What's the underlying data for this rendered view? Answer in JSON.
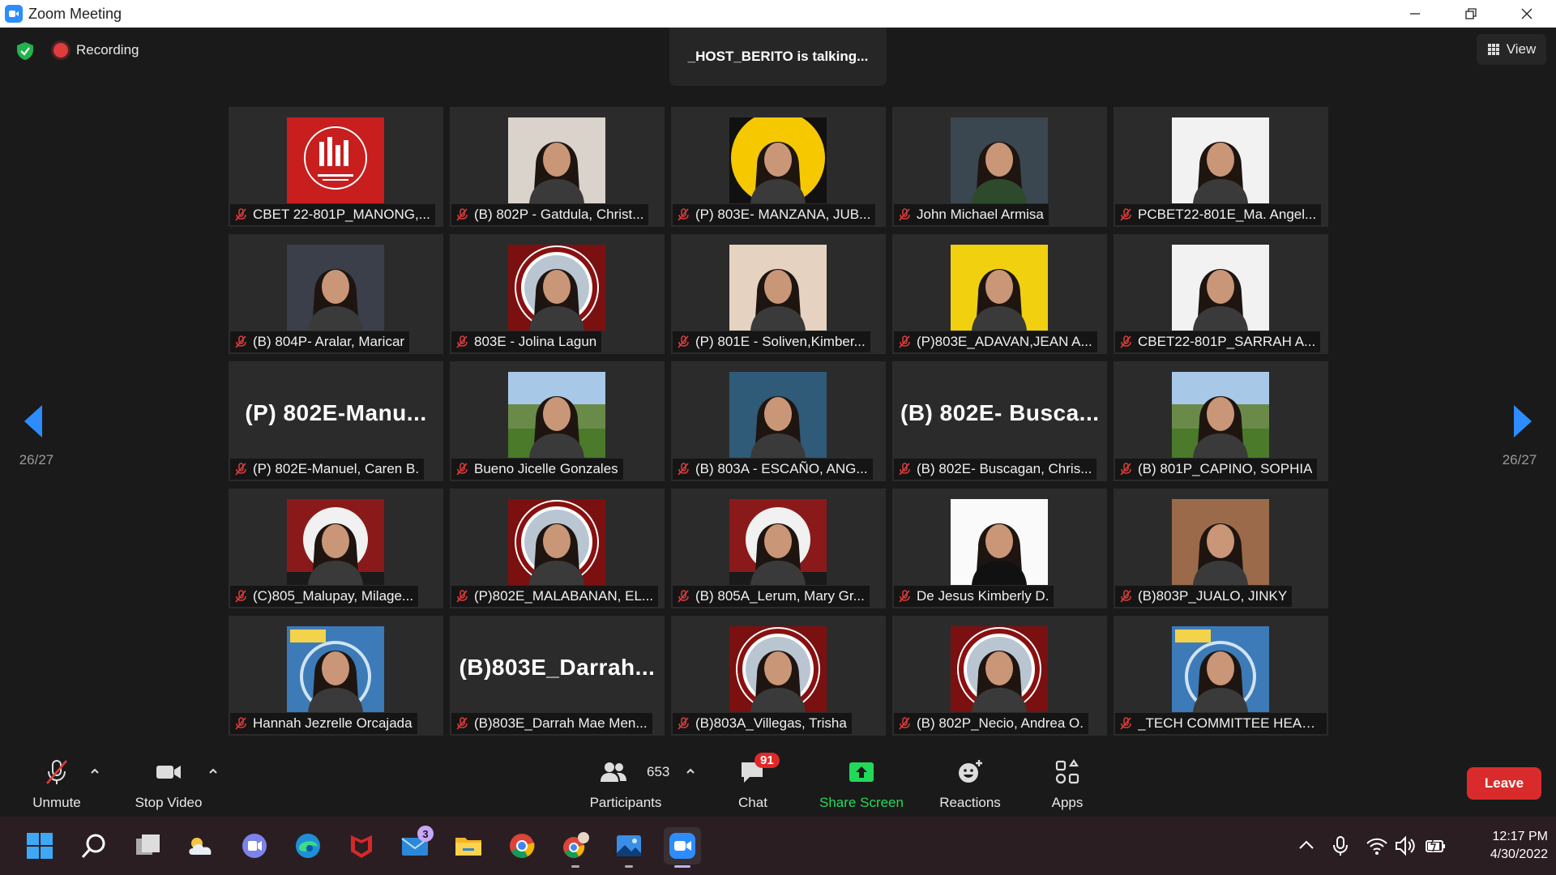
{
  "window": {
    "title": "Zoom Meeting"
  },
  "meeting": {
    "recording_label": "Recording",
    "talking_label": "_HOST_BERITO is talking...",
    "view_label": "View",
    "page_indicator_left": "26/27",
    "page_indicator_right": "26/27"
  },
  "participants": [
    {
      "name": "CBET 22-801P_MANONG,...",
      "avatar": "logo-red",
      "big": ""
    },
    {
      "name": "(B) 802P - Gatdula, Christ...",
      "avatar": "photo-light",
      "big": ""
    },
    {
      "name": "(P) 803E- MANZANA, JUB...",
      "avatar": "photo-yellow-circle",
      "big": ""
    },
    {
      "name": "John Michael Armisa",
      "avatar": "photo-dark-male",
      "big": ""
    },
    {
      "name": "PCBET22-801E_Ma. Angel...",
      "avatar": "photo-white",
      "big": ""
    },
    {
      "name": "(B) 804P- Aralar, Maricar",
      "avatar": "photo-dark",
      "big": ""
    },
    {
      "name": "803E - Jolina Lagun",
      "avatar": "photo-seal",
      "big": ""
    },
    {
      "name": "(P) 801E - Soliven,Kimber...",
      "avatar": "photo-beige",
      "big": ""
    },
    {
      "name": "(P)803E_ADAVAN,JEAN A...",
      "avatar": "photo-yellow",
      "big": ""
    },
    {
      "name": "CBET22-801P_SARRAH A...",
      "avatar": "photo-white",
      "big": ""
    },
    {
      "name": "(P) 802E-Manuel, Caren B.",
      "avatar": "",
      "big": "(P)  802E-Manu..."
    },
    {
      "name": "Bueno Jicelle Gonzales",
      "avatar": "photo-outdoor",
      "big": ""
    },
    {
      "name": "(B) 803A - ESCAÑO, ANG...",
      "avatar": "photo-blue",
      "big": ""
    },
    {
      "name": "(B) 802E- Buscagan, Chris...",
      "avatar": "",
      "big": "(B)  802E-  Busca..."
    },
    {
      "name": "(B) 801P_CAPINO, SOPHIA",
      "avatar": "photo-outdoor",
      "big": ""
    },
    {
      "name": "(C)805_Malupay, Milage...",
      "avatar": "photo-investor",
      "big": ""
    },
    {
      "name": "(P)802E_MALABANAN, EL...",
      "avatar": "photo-seal",
      "big": ""
    },
    {
      "name": "(B) 805A_Lerum, Mary Gr...",
      "avatar": "photo-investor",
      "big": ""
    },
    {
      "name": "De Jesus Kimberly D.",
      "avatar": "photo-white-suit",
      "big": ""
    },
    {
      "name": "(B)803P_JUALO, JINKY",
      "avatar": "photo-brown",
      "big": ""
    },
    {
      "name": "Hannah Jezrelle Orcajada",
      "avatar": "photo-natural",
      "big": ""
    },
    {
      "name": "(B)803E_Darrah Mae Men...",
      "avatar": "",
      "big": "(B)803E_Darrah..."
    },
    {
      "name": "(B)803A_Villegas, Trisha",
      "avatar": "photo-seal",
      "big": ""
    },
    {
      "name": "(B) 802P_Necio, Andrea O.",
      "avatar": "photo-seal",
      "big": ""
    },
    {
      "name": "_TECH COMMITTEE HEAD...",
      "avatar": "photo-natural",
      "big": ""
    }
  ],
  "controls": {
    "unmute": "Unmute",
    "stop_video": "Stop Video",
    "participants": "Participants",
    "participants_count": "653",
    "chat": "Chat",
    "chat_badge": "91",
    "share_screen": "Share Screen",
    "reactions": "Reactions",
    "apps": "Apps",
    "leave": "Leave"
  },
  "taskbar": {
    "mail_badge": "3",
    "time": "12:17 PM",
    "date": "4/30/2022"
  },
  "colors": {
    "accent_blue": "#2d8cff",
    "share_green": "#23d959",
    "leave_red": "#d92b2b",
    "mute_red": "#e03c3c"
  }
}
